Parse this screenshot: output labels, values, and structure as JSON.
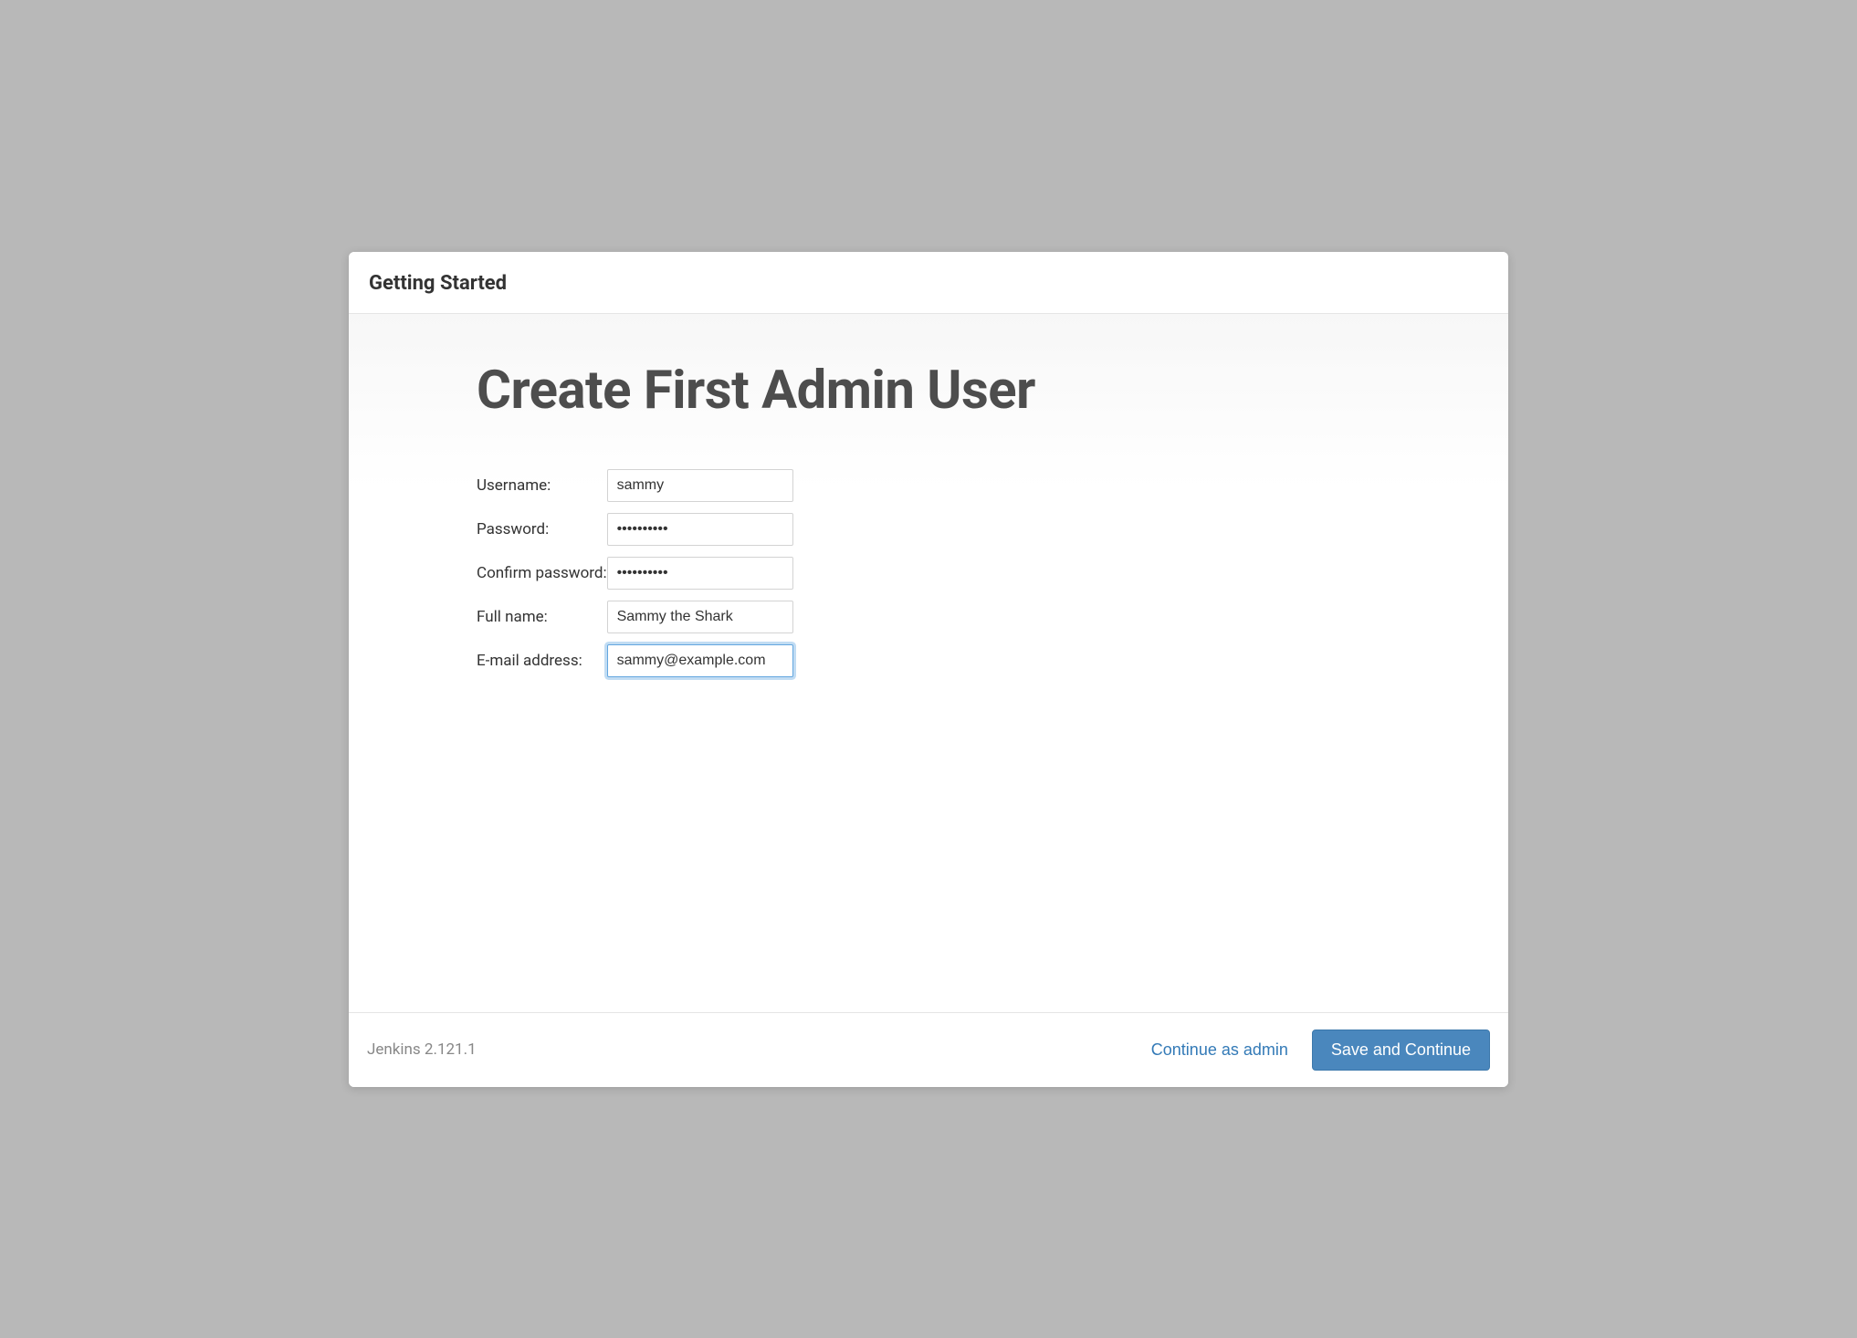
{
  "header": {
    "title": "Getting Started"
  },
  "main": {
    "heading": "Create First Admin User",
    "fields": {
      "username": {
        "label": "Username:",
        "value": "sammy"
      },
      "password": {
        "label": "Password:",
        "value": "••••••••••"
      },
      "confirm_password": {
        "label": "Confirm password:",
        "value": "••••••••••"
      },
      "fullname": {
        "label": "Full name:",
        "value": "Sammy the Shark"
      },
      "email": {
        "label": "E-mail address:",
        "value": "sammy@example.com"
      }
    }
  },
  "footer": {
    "version": "Jenkins 2.121.1",
    "continue_as_admin": "Continue as admin",
    "save_continue": "Save and Continue"
  }
}
